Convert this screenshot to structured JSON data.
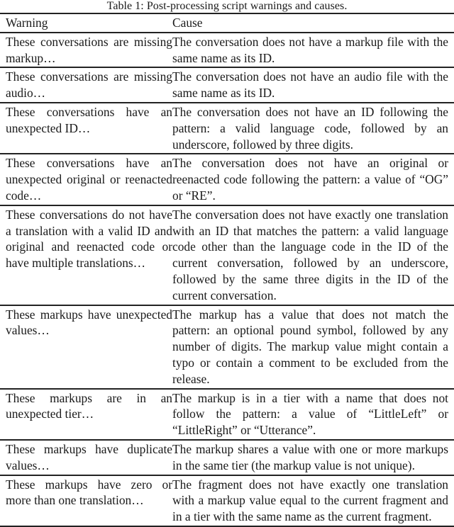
{
  "caption": "Table 1: Post-processing script warnings and causes.",
  "table": {
    "headers": [
      "Warning",
      "Cause"
    ],
    "rows": [
      {
        "warning": "These conversations are missing markup…",
        "cause": "The conversation does not have a markup file with the same name as its ID."
      },
      {
        "warning": "These conversations are missing audio…",
        "cause": "The conversation does not have an audio file with the same name as its ID."
      },
      {
        "warning": "These conversations have an unexpected ID…",
        "cause": "The conversation does not have an ID following the pattern: a valid language code, followed by an underscore, followed by three digits."
      },
      {
        "warning": "These conversations have an unexpected original or reenacted code…",
        "cause": "The conversation does not have an original or reenacted code following the pattern: a value of “OG” or “RE”."
      },
      {
        "warning": "These conversations do not have a translation with a valid ID and original and reenacted code or have multiple translations…",
        "cause": "The conversation does not have exactly one translation with an ID that matches the pattern: a valid language code other than the language code in the ID of the current conversation, followed by an underscore, followed by the same three digits in the ID of the current conversation."
      },
      {
        "warning": "These markups have unexpected values…",
        "cause": "The markup has a value that does not match the pattern: an optional pound symbol, followed by any number of digits. The markup value might contain a typo or contain a comment to be excluded from the release."
      },
      {
        "warning": "These markups are in an unexpected tier…",
        "cause": "The markup is in a tier with a name that does not follow the pattern: a value of “LittleLeft” or “LittleRight” or “Utterance”."
      },
      {
        "warning": "These markups have duplicate values…",
        "cause": "The markup shares a value with one or more markups in the same tier (the markup value is not unique)."
      },
      {
        "warning": "These markups have zero or more than one translation…",
        "cause": "The fragment does not have exactly one translation with a markup value equal to the current fragment and in a tier with the same name as the current fragment."
      }
    ]
  }
}
